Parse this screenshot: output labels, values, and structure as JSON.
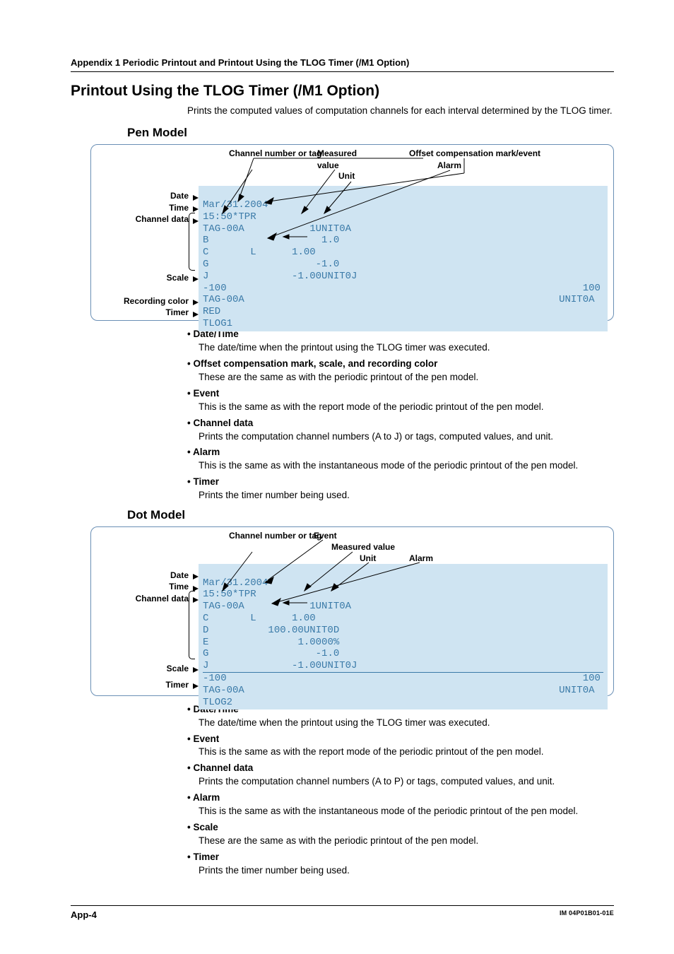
{
  "header": "Appendix 1  Periodic Printout and Printout Using the TLOG Timer (/M1 Option)",
  "section_title": "Printout Using the TLOG Timer (/M1 Option)",
  "intro": "Prints the computed values of computation channels for each interval determined by the TLOG timer.",
  "pen": {
    "title": "Pen Model",
    "top_labels": {
      "channel": "Channel number or tag",
      "measured": "Measured value",
      "unit": "Unit",
      "offset": "Offset compensation mark/event",
      "alarm": "Alarm"
    },
    "left_labels": {
      "date": "Date",
      "time": "Time",
      "channel_data": "Channel data",
      "scale": "Scale",
      "rec_color": "Recording color",
      "timer": "Timer"
    },
    "print": {
      "l1": "Mar/31.2004",
      "l2": "15:50*TPR",
      "l3a": "TAG-00A",
      "l3b": "1UNIT0A",
      "l4a": "B",
      "l4b": "1.0",
      "l5a": "C",
      "l5b": "L",
      "l5c": "1.00",
      "l6a": "G",
      "l6b": "-1.0",
      "l7a": "J",
      "l7b": "-1.00UNIT0J",
      "l8a": "-100",
      "l8b": "100",
      "l9a": "TAG-00A",
      "l9b": "UNIT0A",
      "l10": "RED",
      "l11": "TLOG1"
    },
    "bullets": [
      {
        "h": "Date/Time",
        "b": "The date/time when the printout using the TLOG timer was executed."
      },
      {
        "h": "Offset compensation mark, scale, and recording color",
        "b": "These are the same as with the periodic printout of the pen model."
      },
      {
        "h": "Event",
        "b": "This is the same as with the report mode of the periodic printout of the pen model."
      },
      {
        "h": "Channel data",
        "b": "Prints the computation channel numbers (A to J) or tags, computed values, and unit."
      },
      {
        "h": "Alarm",
        "b": "This is the same as with the instantaneous mode of the periodic printout of the pen model."
      },
      {
        "h": "Timer",
        "b": "Prints the timer number being used."
      }
    ]
  },
  "dot": {
    "title": "Dot Model",
    "top_labels": {
      "channel": "Channel number or tag",
      "event": "Event",
      "measured": "Measured value",
      "unit": "Unit",
      "alarm": "Alarm"
    },
    "left_labels": {
      "date": "Date",
      "time": "Time",
      "channel_data": "Channel data",
      "scale": "Scale",
      "timer": "Timer"
    },
    "print": {
      "l1": "Mar/31.2004",
      "l2": "15:50*TPR",
      "l3a": "TAG-00A",
      "l3b": "1UNIT0A",
      "l4a": "C",
      "l4b": "L",
      "l4c": "1.00",
      "l5a": "D",
      "l5b": "100.00UNIT0D",
      "l6a": "E",
      "l6b": "1.0000%",
      "l7a": "G",
      "l7b": "-1.0",
      "l8a": "J",
      "l8b": "-1.00UNIT0J",
      "l9a": "-100",
      "l9b": "100",
      "l10a": "TAG-00A",
      "l10b": "UNIT0A",
      "l11": "TLOG2"
    },
    "bullets": [
      {
        "h": "Date/Time",
        "b": "The date/time when the printout using the TLOG timer was executed."
      },
      {
        "h": "Event",
        "b": "This is the same as with the report mode of the periodic printout of the pen model."
      },
      {
        "h": "Channel data",
        "b": "Prints the computation channel numbers (A to P) or tags, computed values, and unit."
      },
      {
        "h": "Alarm",
        "b": "This is the same as with the instantaneous mode of the periodic printout of the pen model."
      },
      {
        "h": "Scale",
        "b": "These are the same as with the periodic printout of the pen model."
      },
      {
        "h": "Timer",
        "b": "Prints the timer number being used."
      }
    ]
  },
  "footer": {
    "left": "App-4",
    "right": "IM 04P01B01-01E"
  }
}
